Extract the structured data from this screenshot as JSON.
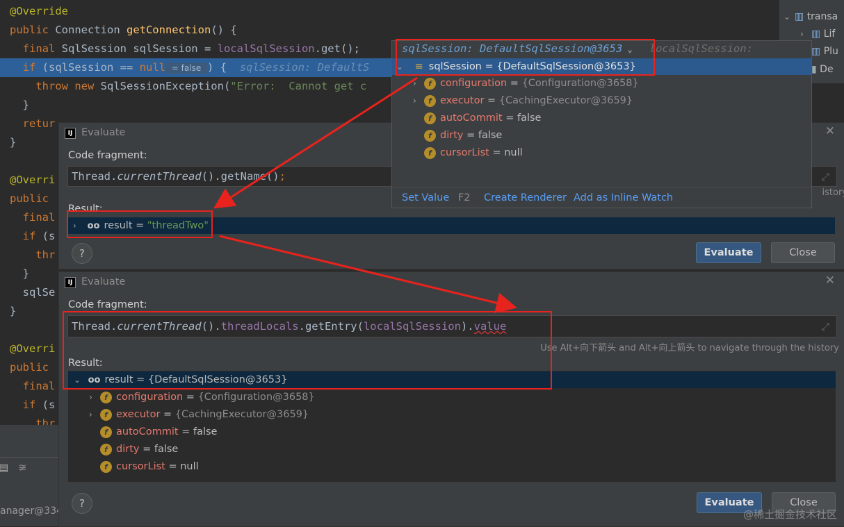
{
  "editor": {
    "lines": [
      {
        "seg": [
          [
            "ann",
            "@Override"
          ]
        ]
      },
      {
        "seg": [
          [
            "kw",
            "public "
          ],
          [
            "cls",
            "Connection "
          ],
          [
            "fn",
            "getConnection"
          ],
          [
            "cls",
            "() {"
          ]
        ]
      },
      {
        "seg": [
          [
            "cls",
            "  "
          ],
          [
            "kw",
            "final "
          ],
          [
            "cls",
            "SqlSession sqlSession = "
          ],
          [
            "fld",
            "localSqlSession"
          ],
          [
            "cls",
            ".get();"
          ]
        ]
      },
      {
        "exec": true,
        "seg": [
          [
            "cls",
            "  "
          ],
          [
            "kw",
            "if "
          ],
          [
            "cls",
            "(sqlSession == "
          ],
          [
            "kw",
            "null"
          ],
          [
            "badge",
            " = false "
          ],
          [
            "cls",
            ") {  "
          ],
          [
            "inline",
            "sqlSession: DefaultS"
          ]
        ]
      },
      {
        "seg": [
          [
            "cls",
            "    "
          ],
          [
            "kw",
            "throw new "
          ],
          [
            "cls",
            "SqlSessionException("
          ],
          [
            "str",
            "\"Error:  Cannot get c"
          ]
        ]
      },
      {
        "seg": [
          [
            "cls",
            "  }"
          ]
        ]
      },
      {
        "seg": [
          [
            "cls",
            "  "
          ],
          [
            "kw",
            "retur"
          ]
        ]
      },
      {
        "seg": [
          [
            "cls",
            "}"
          ]
        ]
      },
      {
        "seg": []
      },
      {
        "seg": [
          [
            "ann",
            "@Overri"
          ]
        ]
      },
      {
        "seg": [
          [
            "kw",
            "public "
          ]
        ]
      },
      {
        "seg": [
          [
            "cls",
            "  "
          ],
          [
            "kw",
            "final"
          ]
        ]
      },
      {
        "seg": [
          [
            "cls",
            "  "
          ],
          [
            "kw",
            "if "
          ],
          [
            "cls",
            "(s"
          ]
        ]
      },
      {
        "seg": [
          [
            "cls",
            "    "
          ],
          [
            "kw",
            "thr"
          ]
        ]
      },
      {
        "seg": [
          [
            "cls",
            "  }"
          ]
        ]
      },
      {
        "seg": [
          [
            "cls",
            "  sqlSe"
          ]
        ]
      },
      {
        "seg": [
          [
            "cls",
            "}"
          ]
        ]
      },
      {
        "seg": []
      },
      {
        "seg": [
          [
            "ann",
            "@Overri"
          ]
        ]
      },
      {
        "seg": [
          [
            "kw",
            "public "
          ]
        ]
      },
      {
        "seg": [
          [
            "cls",
            "  "
          ],
          [
            "kw",
            "final"
          ]
        ]
      },
      {
        "seg": [
          [
            "cls",
            "  "
          ],
          [
            "kw",
            "if "
          ],
          [
            "cls",
            "(s"
          ]
        ]
      },
      {
        "seg": [
          [
            "cls",
            "    "
          ],
          [
            "kw",
            "thr"
          ]
        ]
      }
    ]
  },
  "project_panel": {
    "items": [
      "transa",
      "Lif",
      "Plu",
      "De"
    ]
  },
  "status_text": "anager@334",
  "popup": {
    "title": "sqlSession: DefaultSqlSession@3653",
    "title_trail": "localSqlSession:",
    "selected": "sqlSession = {DefaultSqlSession@3653}",
    "fields": [
      {
        "name": "configuration",
        "value": "{Configuration@3658}",
        "expandable": true,
        "ref": true
      },
      {
        "name": "executor",
        "value": "{CachingExecutor@3659}",
        "expandable": true,
        "ref": true
      },
      {
        "name": "autoCommit",
        "value": "false",
        "expandable": false,
        "ref": false
      },
      {
        "name": "dirty",
        "value": "false",
        "expandable": false,
        "ref": false
      },
      {
        "name": "cursorList",
        "value": "null",
        "expandable": false,
        "ref": false
      }
    ],
    "set_value": "Set Value",
    "set_value_key": "F2",
    "create_renderer": "Create Renderer",
    "add_inline_watch": "Add as Inline Watch"
  },
  "dialog1": {
    "title": "Evaluate",
    "code_label": "Code fragment:",
    "code_a": "Thread.",
    "code_b": "currentThread",
    "code_c": "().getName()",
    "code_d": ";",
    "history_hint": "istory",
    "result_label": "Result:",
    "result_name": "result",
    "result_value": "\"threadTwo\"",
    "evaluate_btn": "Evaluate",
    "close_btn": "Close",
    "help": "?"
  },
  "dialog2": {
    "title": "Evaluate",
    "code_label": "Code fragment:",
    "code_a": "Thread.",
    "code_b": "currentThread",
    "code_c": "().",
    "code_d": "threadLocals",
    "code_e": ".getEntry(",
    "code_f": "localSqlSession",
    "code_g": ").",
    "code_h": "value",
    "history_hint": "Use Alt+向下箭头 and Alt+向上箭头 to navigate through the history",
    "result_label": "Result:",
    "result_name": "result",
    "result_value": "{DefaultSqlSession@3653}",
    "fields": [
      {
        "name": "configuration",
        "value": "{Configuration@3658}",
        "expandable": true,
        "ref": true
      },
      {
        "name": "executor",
        "value": "{CachingExecutor@3659}",
        "expandable": true,
        "ref": true
      },
      {
        "name": "autoCommit",
        "value": "false",
        "expandable": false,
        "ref": false
      },
      {
        "name": "dirty",
        "value": "false",
        "expandable": false,
        "ref": false
      },
      {
        "name": "cursorList",
        "value": "null",
        "expandable": false,
        "ref": false
      }
    ],
    "evaluate_btn": "Evaluate",
    "close_btn": "Close",
    "help": "?"
  },
  "watermark": "@稀土掘金技术社区",
  "colors": {
    "annotation_red": "#e8231d",
    "selection_blue": "#2d5a8e",
    "exec_line": "#2d6099"
  }
}
